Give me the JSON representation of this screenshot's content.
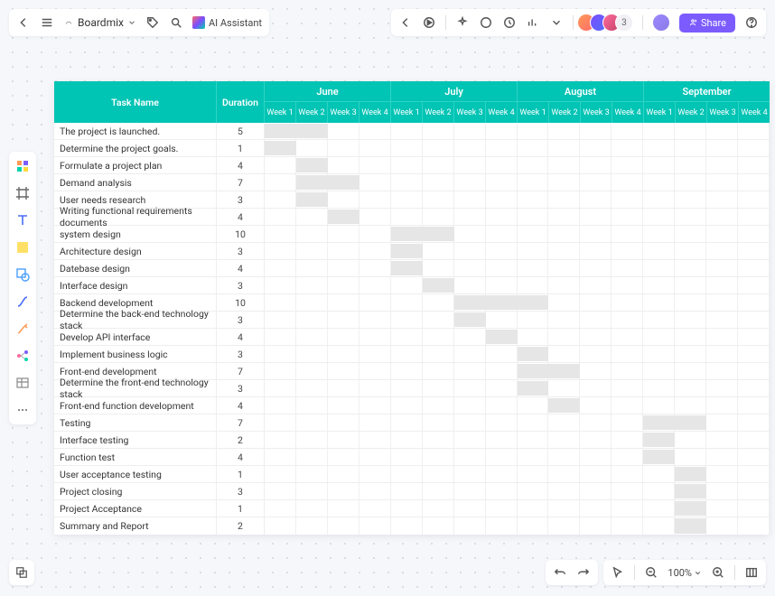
{
  "toolbar": {
    "brand": "Boardmix",
    "ai_label": "AI Assistant",
    "share_label": "Share",
    "avatar_count": "3"
  },
  "bottom": {
    "zoom": "100%"
  },
  "table": {
    "h_task": "Task Name",
    "h_dur": "Duration",
    "months": [
      "June",
      "July",
      "August",
      "September"
    ],
    "weeks": [
      "Week 1",
      "Week 2",
      "Week 3",
      "Week 4"
    ],
    "rows": [
      {
        "task": "The project is launched.",
        "dur": "5",
        "start": 0,
        "span": 2
      },
      {
        "task": "Determine the project goals.",
        "dur": "1",
        "start": 0,
        "span": 1
      },
      {
        "task": "Formulate a project plan",
        "dur": "4",
        "start": 1,
        "span": 1
      },
      {
        "task": "Demand analysis",
        "dur": "7",
        "start": 1,
        "span": 2
      },
      {
        "task": "User needs research",
        "dur": "3",
        "start": 1,
        "span": 1
      },
      {
        "task": "Writing functional requirements documents",
        "dur": "4",
        "start": 2,
        "span": 1
      },
      {
        "task": "system design",
        "dur": "10",
        "start": 4,
        "span": 2
      },
      {
        "task": "Architecture design",
        "dur": "3",
        "start": 4,
        "span": 1
      },
      {
        "task": "Datebase design",
        "dur": "4",
        "start": 4,
        "span": 1
      },
      {
        "task": "Interface design",
        "dur": "3",
        "start": 5,
        "span": 1
      },
      {
        "task": "Backend development",
        "dur": "10",
        "start": 6,
        "span": 3
      },
      {
        "task": "Determine the back-end technology stack",
        "dur": "3",
        "start": 6,
        "span": 1
      },
      {
        "task": "Develop API interface",
        "dur": "4",
        "start": 7,
        "span": 1
      },
      {
        "task": "Implement business logic",
        "dur": "3",
        "start": 8,
        "span": 1
      },
      {
        "task": "Front-end development",
        "dur": "7",
        "start": 8,
        "span": 2
      },
      {
        "task": "Determine the front-end technology stack",
        "dur": "3",
        "start": 8,
        "span": 1
      },
      {
        "task": "Front-end function development",
        "dur": "4",
        "start": 9,
        "span": 1
      },
      {
        "task": "Testing",
        "dur": "7",
        "start": 12,
        "span": 2
      },
      {
        "task": "Interface testing",
        "dur": "2",
        "start": 12,
        "span": 1
      },
      {
        "task": "Function test",
        "dur": "4",
        "start": 12,
        "span": 1
      },
      {
        "task": "User acceptance testing",
        "dur": "1",
        "start": 13,
        "span": 1
      },
      {
        "task": "Project closing",
        "dur": "3",
        "start": 13,
        "span": 1
      },
      {
        "task": "Project Acceptance",
        "dur": "1",
        "start": 13,
        "span": 1
      },
      {
        "task": "Summary and Report",
        "dur": "2",
        "start": 13,
        "span": 1
      }
    ]
  }
}
